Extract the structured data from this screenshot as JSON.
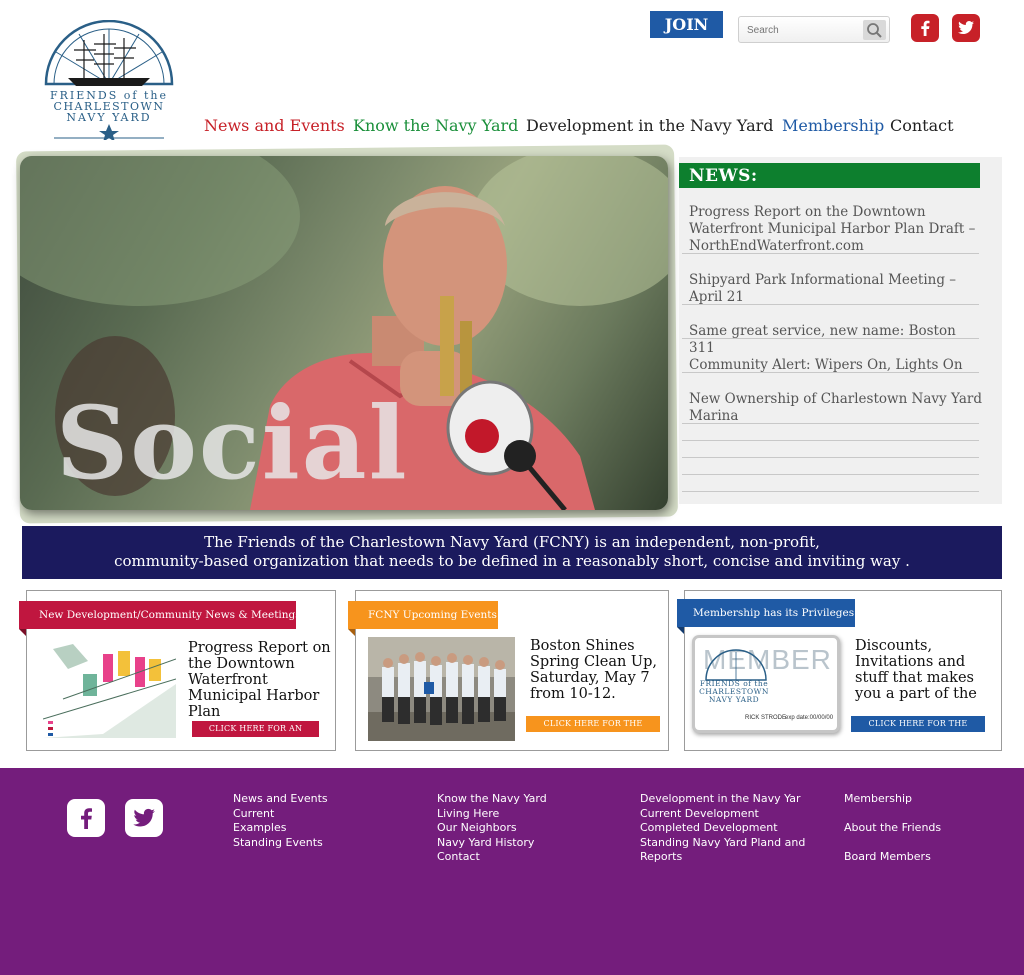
{
  "header": {
    "logo_text": [
      "FRIENDS of the",
      "CHARLESTOWN",
      "NAVY YARD"
    ],
    "join_label": "JOIN",
    "search_placeholder": "Search",
    "nav": [
      {
        "label": "News and Events",
        "color": "#c72128"
      },
      {
        "label": "Know the Navy Yard",
        "color": "#1a8f3a"
      },
      {
        "label": "Development in the Navy Yard",
        "color": "#222222"
      },
      {
        "label": "Membership",
        "color": "#1f5aa5"
      },
      {
        "label": "Contact",
        "color": "#222222"
      }
    ]
  },
  "hero": {
    "caption": "Social"
  },
  "news": {
    "heading": "NEWS:",
    "items": [
      "Progress Report on the Downtown Waterfront Municipal Harbor Plan Draft – NorthEndWaterfront.com",
      "Shipyard Park Informational Meeting – April 21",
      "Same great service, new name: Boston 311",
      "Community Alert: Wipers On, Lights On",
      "New Ownership of Charlestown Navy Yard Marina"
    ]
  },
  "mission": {
    "line1": "The Friends of the Charlestown Navy Yard (FCNY) is an independent, non-profit,",
    "line2": "community-based organization that needs to be defined in a reasonably short, concise and inviting way ."
  },
  "cards": [
    {
      "tag": "New Development/Community News & Meetings",
      "tag_color": "#c0163f",
      "title": "Progress Report on the Downtown Waterfront Municipal Harbor Plan",
      "button": "CLICK HERE FOR AN UPDATE",
      "button_color": "#c0163f"
    },
    {
      "tag": "FCNY Upcoming Events",
      "tag_color": "#f7941d",
      "title": "Boston Shines Spring Clean Up, Saturday, May 7 from 10-12.",
      "button": "CLICK HERE FOR THE DETAILS",
      "button_color": "#f7941d"
    },
    {
      "tag": "Membership has its Privileges",
      "tag_color": "#1f5aa5",
      "title": "Discounts, Invitations and stuff that makes you a part of the",
      "button": "CLICK HERE FOR THE BENEFITS",
      "button_color": "#1f5aa5",
      "member_card": {
        "word": "MEMBER",
        "logo_text": [
          "FRIENDS of the",
          "CHARLESTOWN",
          "NAVY YARD"
        ],
        "name": "RICK STRODE",
        "exp": "exp date:00/00/00"
      }
    }
  ],
  "footer": {
    "col1": [
      "News and Events",
      "Current",
      "Examples",
      "Standing Events"
    ],
    "col2": [
      "Know the Navy Yard",
      "Living Here",
      "Our Neighbors",
      "Navy Yard History",
      "Contact"
    ],
    "col3": [
      "Development in the Navy Yar",
      "Current Development",
      "Completed Development",
      "Standing Navy Yard Pland and",
      "Reports"
    ],
    "col4": [
      "Membership",
      "About the Friends",
      "Board Members"
    ]
  },
  "colors": {
    "primary_blue": "#1f5aa5",
    "news_green": "#0d7f2e",
    "mission_navy": "#1b1a5e",
    "footer_purple": "#741d7c",
    "social_red": "#c72128"
  },
  "icons": [
    "search-icon",
    "facebook-icon",
    "twitter-icon"
  ]
}
